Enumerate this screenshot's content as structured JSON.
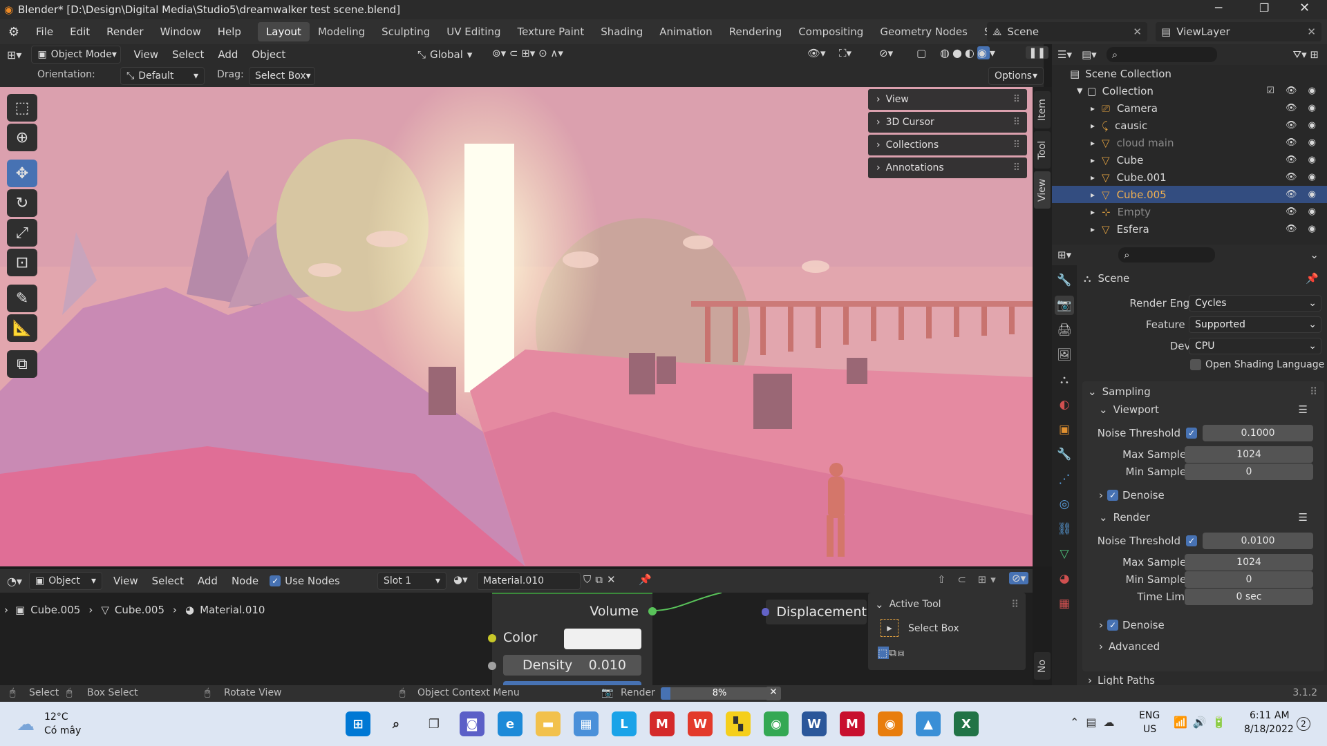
{
  "window": {
    "title": "Blender* [D:\\Design\\Digital Media\\Studio5\\dreamwalker test scene.blend]"
  },
  "menu": [
    "File",
    "Edit",
    "Render",
    "Window",
    "Help"
  ],
  "workspaces": [
    "Layout",
    "Modeling",
    "Sculpting",
    "UV Editing",
    "Texture Paint",
    "Shading",
    "Animation",
    "Rendering",
    "Compositing",
    "Geometry Nodes",
    "Scripting"
  ],
  "scene": {
    "name": "Scene",
    "view_layer": "ViewLayer"
  },
  "viewport_header": {
    "mode": "Object Mode",
    "menus": [
      "View",
      "Select",
      "Add",
      "Object"
    ],
    "transform": "Global",
    "orientation_label": "Orientation:",
    "orientation": "Default",
    "drag_label": "Drag:",
    "drag": "Select Box",
    "options": "Options"
  },
  "npanel": {
    "sections": [
      "View",
      "3D Cursor",
      "Collections",
      "Annotations"
    ],
    "tabs": [
      "Item",
      "Tool",
      "View"
    ]
  },
  "outliner": {
    "root": "Scene Collection",
    "collection": "Collection",
    "items": [
      {
        "name": "Camera",
        "icon": "camera-icon",
        "color": "#e0a040"
      },
      {
        "name": "causic",
        "icon": "armature-icon",
        "color": "#e0a040"
      },
      {
        "name": "cloud main",
        "icon": "mesh-icon",
        "color": "#e0a040",
        "dim": true
      },
      {
        "name": "Cube",
        "icon": "mesh-icon",
        "color": "#e0a040"
      },
      {
        "name": "Cube.001",
        "icon": "mesh-icon",
        "color": "#e0a040"
      },
      {
        "name": "Cube.005",
        "icon": "mesh-icon",
        "color": "#e0a040",
        "selected": true
      },
      {
        "name": "Empty",
        "icon": "empty-icon",
        "color": "#e0a040",
        "dim": true
      },
      {
        "name": "Esfera",
        "icon": "mesh-icon",
        "color": "#e0a040"
      }
    ]
  },
  "properties": {
    "context": "Scene",
    "render_engine_label": "Render Engine",
    "render_engine": "Cycles",
    "feature_set_label": "Feature Set",
    "feature_set": "Supported",
    "device_label": "Device",
    "device": "CPU",
    "osl_label": "Open Shading Language",
    "sampling": "Sampling",
    "viewport": {
      "title": "Viewport",
      "noise_threshold_label": "Noise Threshold",
      "noise_threshold": "0.1000",
      "max_samples_label": "Max Samples",
      "max_samples": "1024",
      "min_samples_label": "Min Samples",
      "min_samples": "0",
      "denoise": "Denoise"
    },
    "render": {
      "title": "Render",
      "noise_threshold_label": "Noise Threshold",
      "noise_threshold": "0.0100",
      "max_samples_label": "Max Samples",
      "max_samples": "1024",
      "min_samples_label": "Min Samples",
      "min_samples": "0",
      "time_limit_label": "Time Limit",
      "time_limit": "0 sec",
      "denoise": "Denoise"
    },
    "advanced": "Advanced",
    "light_paths": "Light Paths"
  },
  "node_editor": {
    "mode": "Object",
    "menus": [
      "View",
      "Select",
      "Add",
      "Node"
    ],
    "use_nodes": "Use Nodes",
    "slot": "Slot 1",
    "material": "Material.010",
    "breadcrumb": [
      "Cube.005",
      "Cube.005",
      "Material.010"
    ],
    "node": {
      "output": "Volume",
      "color_label": "Color",
      "density_label": "Density",
      "density": "0.010"
    },
    "displacement": "Displacement",
    "active_tool_title": "Active Tool",
    "active_tool": "Select Box",
    "side_tab": "No"
  },
  "status": {
    "select": "Select",
    "box_select": "Box Select",
    "rotate_view": "Rotate View",
    "context_menu": "Object Context Menu",
    "render_label": "Render",
    "render_progress": "8%",
    "render_fraction": 0.08,
    "version": "3.1.2"
  },
  "taskbar": {
    "weather_temp": "12°C",
    "weather_desc": "Có mây",
    "lang": "ENG",
    "region": "US",
    "time": "6:11 AM",
    "date": "8/18/2022",
    "notifications": "2"
  }
}
